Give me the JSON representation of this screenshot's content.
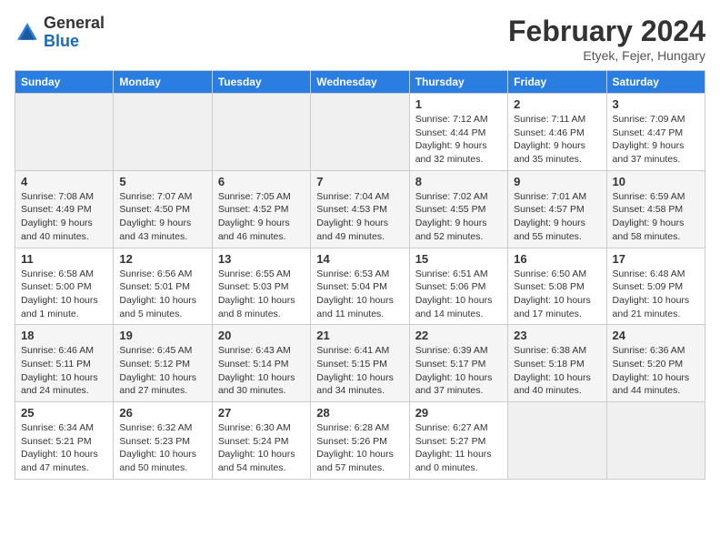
{
  "header": {
    "logo_general": "General",
    "logo_blue": "Blue",
    "month_title": "February 2024",
    "location": "Etyek, Fejer, Hungary"
  },
  "days_of_week": [
    "Sunday",
    "Monday",
    "Tuesday",
    "Wednesday",
    "Thursday",
    "Friday",
    "Saturday"
  ],
  "weeks": [
    [
      {
        "day": "",
        "info": ""
      },
      {
        "day": "",
        "info": ""
      },
      {
        "day": "",
        "info": ""
      },
      {
        "day": "",
        "info": ""
      },
      {
        "day": "1",
        "info": "Sunrise: 7:12 AM\nSunset: 4:44 PM\nDaylight: 9 hours and 32 minutes."
      },
      {
        "day": "2",
        "info": "Sunrise: 7:11 AM\nSunset: 4:46 PM\nDaylight: 9 hours and 35 minutes."
      },
      {
        "day": "3",
        "info": "Sunrise: 7:09 AM\nSunset: 4:47 PM\nDaylight: 9 hours and 37 minutes."
      }
    ],
    [
      {
        "day": "4",
        "info": "Sunrise: 7:08 AM\nSunset: 4:49 PM\nDaylight: 9 hours and 40 minutes."
      },
      {
        "day": "5",
        "info": "Sunrise: 7:07 AM\nSunset: 4:50 PM\nDaylight: 9 hours and 43 minutes."
      },
      {
        "day": "6",
        "info": "Sunrise: 7:05 AM\nSunset: 4:52 PM\nDaylight: 9 hours and 46 minutes."
      },
      {
        "day": "7",
        "info": "Sunrise: 7:04 AM\nSunset: 4:53 PM\nDaylight: 9 hours and 49 minutes."
      },
      {
        "day": "8",
        "info": "Sunrise: 7:02 AM\nSunset: 4:55 PM\nDaylight: 9 hours and 52 minutes."
      },
      {
        "day": "9",
        "info": "Sunrise: 7:01 AM\nSunset: 4:57 PM\nDaylight: 9 hours and 55 minutes."
      },
      {
        "day": "10",
        "info": "Sunrise: 6:59 AM\nSunset: 4:58 PM\nDaylight: 9 hours and 58 minutes."
      }
    ],
    [
      {
        "day": "11",
        "info": "Sunrise: 6:58 AM\nSunset: 5:00 PM\nDaylight: 10 hours and 1 minute."
      },
      {
        "day": "12",
        "info": "Sunrise: 6:56 AM\nSunset: 5:01 PM\nDaylight: 10 hours and 5 minutes."
      },
      {
        "day": "13",
        "info": "Sunrise: 6:55 AM\nSunset: 5:03 PM\nDaylight: 10 hours and 8 minutes."
      },
      {
        "day": "14",
        "info": "Sunrise: 6:53 AM\nSunset: 5:04 PM\nDaylight: 10 hours and 11 minutes."
      },
      {
        "day": "15",
        "info": "Sunrise: 6:51 AM\nSunset: 5:06 PM\nDaylight: 10 hours and 14 minutes."
      },
      {
        "day": "16",
        "info": "Sunrise: 6:50 AM\nSunset: 5:08 PM\nDaylight: 10 hours and 17 minutes."
      },
      {
        "day": "17",
        "info": "Sunrise: 6:48 AM\nSunset: 5:09 PM\nDaylight: 10 hours and 21 minutes."
      }
    ],
    [
      {
        "day": "18",
        "info": "Sunrise: 6:46 AM\nSunset: 5:11 PM\nDaylight: 10 hours and 24 minutes."
      },
      {
        "day": "19",
        "info": "Sunrise: 6:45 AM\nSunset: 5:12 PM\nDaylight: 10 hours and 27 minutes."
      },
      {
        "day": "20",
        "info": "Sunrise: 6:43 AM\nSunset: 5:14 PM\nDaylight: 10 hours and 30 minutes."
      },
      {
        "day": "21",
        "info": "Sunrise: 6:41 AM\nSunset: 5:15 PM\nDaylight: 10 hours and 34 minutes."
      },
      {
        "day": "22",
        "info": "Sunrise: 6:39 AM\nSunset: 5:17 PM\nDaylight: 10 hours and 37 minutes."
      },
      {
        "day": "23",
        "info": "Sunrise: 6:38 AM\nSunset: 5:18 PM\nDaylight: 10 hours and 40 minutes."
      },
      {
        "day": "24",
        "info": "Sunrise: 6:36 AM\nSunset: 5:20 PM\nDaylight: 10 hours and 44 minutes."
      }
    ],
    [
      {
        "day": "25",
        "info": "Sunrise: 6:34 AM\nSunset: 5:21 PM\nDaylight: 10 hours and 47 minutes."
      },
      {
        "day": "26",
        "info": "Sunrise: 6:32 AM\nSunset: 5:23 PM\nDaylight: 10 hours and 50 minutes."
      },
      {
        "day": "27",
        "info": "Sunrise: 6:30 AM\nSunset: 5:24 PM\nDaylight: 10 hours and 54 minutes."
      },
      {
        "day": "28",
        "info": "Sunrise: 6:28 AM\nSunset: 5:26 PM\nDaylight: 10 hours and 57 minutes."
      },
      {
        "day": "29",
        "info": "Sunrise: 6:27 AM\nSunset: 5:27 PM\nDaylight: 11 hours and 0 minutes."
      },
      {
        "day": "",
        "info": ""
      },
      {
        "day": "",
        "info": ""
      }
    ]
  ]
}
